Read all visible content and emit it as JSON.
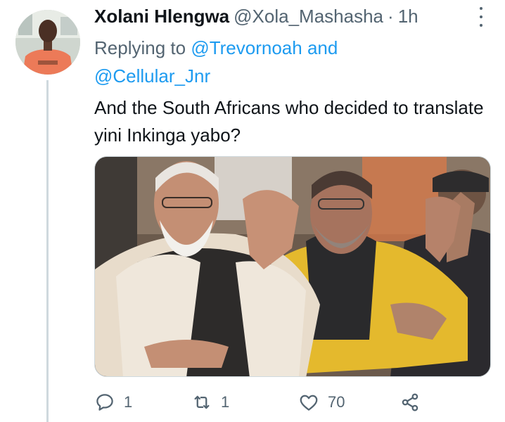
{
  "tweet": {
    "author_name": "Xolani Hlengwa",
    "author_handle": "@Xola_Mashasha",
    "separator": "·",
    "time": "1h",
    "replying_prefix": "Replying to",
    "replying_mention_1": "@Trevornoah",
    "replying_and": "and",
    "replying_mention_2": "@Cellular_Jnr",
    "text": "And the South Africans who decided to translate yini Inkinga yabo?",
    "avatar_icon": "profile-photo",
    "media_icon": "photo-two-men-clapping"
  },
  "actions": {
    "reply": {
      "icon": "reply-bubble-icon",
      "count": "1"
    },
    "retweet": {
      "icon": "retweet-icon",
      "count": "1"
    },
    "like": {
      "icon": "heart-icon",
      "count": "70"
    },
    "share": {
      "icon": "share-icon"
    }
  },
  "colors": {
    "link": "#1d9bf0",
    "secondary_text": "#536471",
    "primary_text": "#0f1419",
    "thread_line": "#cfd9de"
  }
}
